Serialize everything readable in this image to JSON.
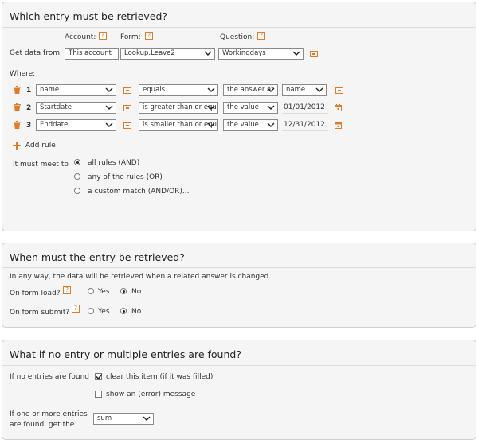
{
  "section1": {
    "title": "Which entry must be retrieved?",
    "col_account": "Account:",
    "col_form": "Form:",
    "col_question": "Question:",
    "get_data_from": "Get data from",
    "account_value": "This account",
    "form_value": "Lookup.Leave2",
    "question_value": "Workingdays",
    "where_label": "Where:",
    "rows": [
      {
        "num": "1",
        "field": "name",
        "operator": "equals...",
        "source": "the answer at",
        "value": "name",
        "value_type": "select"
      },
      {
        "num": "2",
        "field": "Startdate",
        "operator": "is greater than or equa",
        "source": "the value",
        "value": "01/01/2012",
        "value_type": "date"
      },
      {
        "num": "3",
        "field": "Enddate",
        "operator": "is smaller than or equa",
        "source": "the value",
        "value": "12/31/2012",
        "value_type": "date"
      }
    ],
    "add_rule": "Add rule",
    "must_meet": "It must meet to",
    "options": [
      "all rules (AND)",
      "any of the rules (OR)",
      "a custom match (AND/OR)..."
    ],
    "selected_option": 0
  },
  "section2": {
    "title": "When must the entry be retrieved?",
    "note": "In any way, the data will be retrieved when a related answer is changed.",
    "load_label": "On form load?",
    "submit_label": "On form submit?",
    "yes": "Yes",
    "no": "No",
    "load_selected": "No",
    "submit_selected": "No"
  },
  "section3": {
    "title": "What if no entry or multiple entries are found?",
    "if_none": "If no entries are found",
    "clear_item": "clear this item (if it was filled)",
    "clear_checked": true,
    "show_error": "show an (error) message",
    "show_error_checked": false,
    "if_many_line1": "If one or more entries",
    "if_many_line2": "are found, get the",
    "aggregate_value": "sum"
  },
  "icons": {
    "help": "?",
    "accent": "#e07b2a"
  }
}
